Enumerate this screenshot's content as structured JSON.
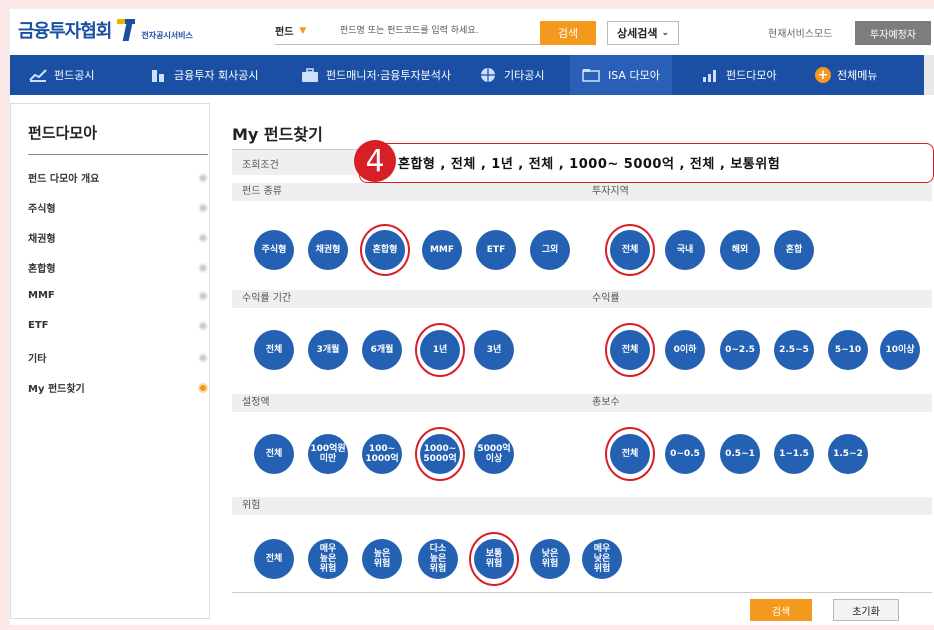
{
  "header": {
    "logo_text": "금융투자협회",
    "logo_sub": "전자공시서비스",
    "fund_select": "펀드",
    "search_placeholder": "펀드명 또는 펀드코드를 입력 하세요.",
    "search_button": "검색",
    "detail_search": "상세검색",
    "mode_text": "현재서비스모드",
    "mode_button": "투자예정자"
  },
  "nav": {
    "items": [
      {
        "label": "펀드공시",
        "icon": "chart-icon"
      },
      {
        "label": "금융투자 회사공시",
        "icon": "building-icon"
      },
      {
        "label": "펀드매니저·금융투자분석사",
        "icon": "briefcase-icon"
      },
      {
        "label": "기타공시",
        "icon": "globe-icon"
      },
      {
        "label": "ISA 다모아",
        "icon": "folder-icon"
      },
      {
        "label": "펀드다모아",
        "icon": "bar-chart-icon"
      },
      {
        "label": "전체메뉴",
        "icon": "plus-icon"
      }
    ]
  },
  "sidebar": {
    "title": "펀드다모아",
    "items": [
      {
        "label": "펀드 다모아 개요"
      },
      {
        "label": "주식형"
      },
      {
        "label": "채권형"
      },
      {
        "label": "혼합형"
      },
      {
        "label": "MMF"
      },
      {
        "label": "ETF"
      },
      {
        "label": "기타"
      },
      {
        "label": "My 펀드찾기",
        "active": true
      }
    ]
  },
  "main": {
    "title": "My 펀드찾기",
    "condition_label": "조회조건",
    "callout_number": "4",
    "callout_text": "혼합형 , 전체 , 1년 , 전체 , 1000~ 5000억 , 전체 , 보통위험",
    "sections": {
      "fund_type": {
        "title": "펀드 종류",
        "options": [
          "주식형",
          "채권형",
          "혼합형",
          "MMF",
          "ETF",
          "그외"
        ],
        "selected": "혼합형"
      },
      "region": {
        "title": "투자지역",
        "options": [
          "전체",
          "국내",
          "해외",
          "혼합"
        ],
        "selected": "전체"
      },
      "return_period": {
        "title": "수익률 기간",
        "options": [
          "전체",
          "3개월",
          "6개월",
          "1년",
          "3년"
        ],
        "selected": "1년"
      },
      "return_rate": {
        "title": "수익률",
        "options": [
          "전체",
          "0이하",
          "0~2.5",
          "2.5~5",
          "5~10",
          "10이상"
        ],
        "selected": "전체"
      },
      "size": {
        "title": "설정액",
        "options": [
          "전체",
          "100억원\n미만",
          "100~\n1000억",
          "1000~\n5000억",
          "5000억\n이상"
        ],
        "selected": "1000~\n5000억"
      },
      "fee": {
        "title": "총보수",
        "options": [
          "전체",
          "0~0.5",
          "0.5~1",
          "1~1.5",
          "1.5~2"
        ],
        "selected": "전체"
      },
      "risk": {
        "title": "위험",
        "options": [
          "전체",
          "매우\n높은\n위험",
          "높은\n위험",
          "다소\n높은\n위험",
          "보통\n위험",
          "낮은\n위험",
          "매우\n낮은\n위험"
        ],
        "selected": "보통\n위험"
      }
    },
    "search_button": "검색",
    "reset_button": "초기화"
  },
  "colors": {
    "brand_blue": "#1b4fa3",
    "option_blue": "#2461b2",
    "accent_orange": "#f39a1e",
    "highlight_red": "#d81f26"
  }
}
